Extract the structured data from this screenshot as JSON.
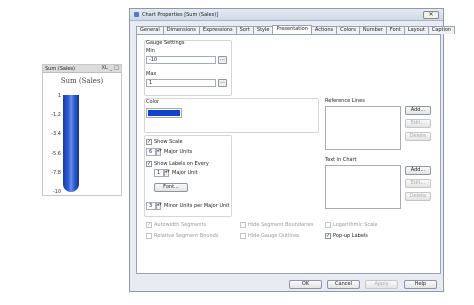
{
  "chart": {
    "caption": "Sum (Sales)",
    "caption_icons": [
      "XL",
      "_",
      "□"
    ],
    "title": "Sum (Sales)",
    "ticks": [
      "1",
      "-1.2",
      "-3.4",
      "-5.6",
      "-7.8",
      "-10"
    ],
    "fill_fraction": 1.0,
    "gauge_color": "#2f5fd8"
  },
  "dialog": {
    "title": "Chart Properties [Sum (Sales)]",
    "close": "✕",
    "tabs": [
      "General",
      "Dimensions",
      "Expressions",
      "Sort",
      "Style",
      "Presentation",
      "Actions",
      "Colors",
      "Number",
      "Font",
      "Layout",
      "Caption"
    ],
    "active_tab": "Presentation",
    "gauge_settings": {
      "label": "Gauge Settings",
      "min_label": "Min",
      "min_value": "-10",
      "max_label": "Max",
      "max_value": "1",
      "dots": "..."
    },
    "color": {
      "label": "Color",
      "value": "#1144cc"
    },
    "show_scale": {
      "label": "Show Scale",
      "checked": "✓"
    },
    "major_units": {
      "value": "6",
      "label": "Major Units"
    },
    "show_labels": {
      "label": "Show Labels on Every",
      "checked": "✓"
    },
    "major_unit": {
      "value": "1",
      "label": "Major Unit"
    },
    "font_button": "Font...",
    "minor_units": {
      "value": "3",
      "label": "Minor Units per Major Unit"
    },
    "reference_lines": {
      "label": "Reference Lines",
      "add": "Add...",
      "edit": "Edit...",
      "delete": "Delete"
    },
    "text_in_chart": {
      "label": "Text in Chart",
      "add": "Add...",
      "edit": "Edit...",
      "delete": "Delete"
    },
    "options": {
      "autowidth": "Autowidth Segments",
      "relative": "Relative Segment Bounds",
      "hide_boundaries": "Hide Segment Boundaries",
      "hide_outlines": "Hide Gauge Outlines",
      "logarithmic": "Logarithmic Scale",
      "popup": "Pop-up Labels"
    },
    "footer": {
      "ok": "OK",
      "cancel": "Cancel",
      "apply": "Apply",
      "help": "Help"
    }
  }
}
